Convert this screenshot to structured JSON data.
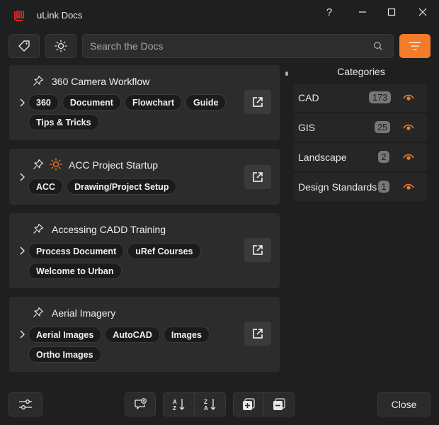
{
  "window": {
    "title": "uLink Docs",
    "help": "?",
    "minimize": "–",
    "maximize": "☐",
    "close": "✕"
  },
  "search": {
    "placeholder": "Search the Docs"
  },
  "colors": {
    "accent": "#f47b2a",
    "background": "#1f1f1f",
    "card": "#2c2c2c"
  },
  "docs": [
    {
      "title": "360 Camera Workflow",
      "tags": [
        "360",
        "Document",
        "Flowchart",
        "Guide",
        "Tips & Tricks"
      ]
    },
    {
      "title": "ACC Project Startup",
      "tags": [
        "ACC",
        "Drawing/Project Setup"
      ]
    },
    {
      "title": "Accessing CADD Training",
      "tags": [
        "Process Document",
        "uRef Courses",
        "Welcome to Urban"
      ]
    },
    {
      "title": "Aerial Imagery",
      "tags": [
        "Aerial Images",
        "AutoCAD",
        "Images",
        "Ortho Images"
      ]
    }
  ],
  "categories": {
    "header": "Categories",
    "items": [
      {
        "name": "CAD",
        "count": "173"
      },
      {
        "name": "GIS",
        "count": "25"
      },
      {
        "name": "Landscape",
        "count": "2"
      },
      {
        "name": "Design Standards",
        "count": "1"
      }
    ]
  },
  "footer": {
    "close_label": "Close"
  }
}
